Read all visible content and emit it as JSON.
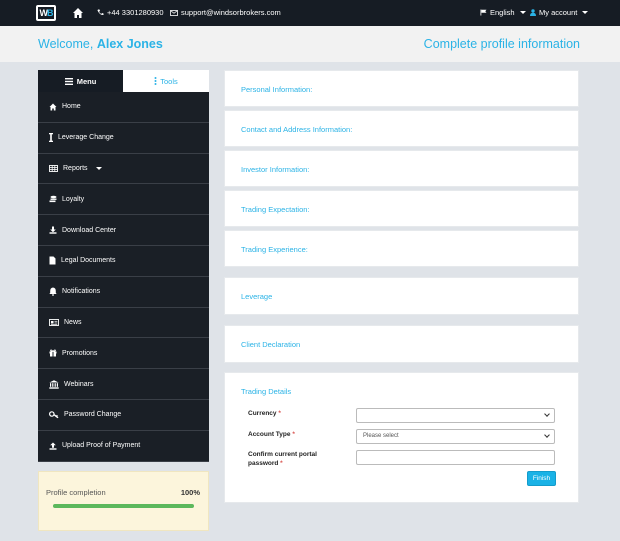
{
  "topbar": {
    "logo_w": "W",
    "logo_b": "B",
    "phone": "+44 3301280930",
    "email": "support@windsorbrokers.com",
    "language": "English",
    "account": "My account"
  },
  "welcome": {
    "greeting": "Welcome,",
    "user_name": "Alex Jones",
    "complete_profile": "Complete profile information"
  },
  "sidebar": {
    "tabs": {
      "menu": "Menu",
      "tools": "Tools"
    },
    "items": [
      {
        "label": "Home",
        "icon": "home-icon"
      },
      {
        "label": "Leverage Change",
        "icon": "leverage-icon"
      },
      {
        "label": "Reports",
        "icon": "table-icon"
      },
      {
        "label": "Loyalty",
        "icon": "coins-icon"
      },
      {
        "label": "Download Center",
        "icon": "download-icon"
      },
      {
        "label": "Legal Documents",
        "icon": "file-icon"
      },
      {
        "label": "Notifications",
        "icon": "bell-icon"
      },
      {
        "label": "News",
        "icon": "newspaper-icon"
      },
      {
        "label": "Promotions",
        "icon": "gift-icon"
      },
      {
        "label": "Webinars",
        "icon": "bank-icon"
      },
      {
        "label": "Password Change",
        "icon": "key-icon"
      },
      {
        "label": "Upload Proof of Payment",
        "icon": "upload-icon"
      }
    ],
    "profile_completion": {
      "label": "Profile completion",
      "value": "100%",
      "fraction": 1.0
    }
  },
  "sections": {
    "personal": "Personal Information:",
    "contact": "Contact and Address Information:",
    "investor": "Investor Information:",
    "trading_expectation": "Trading Expectation:",
    "trading_experience": "Trading Experience:",
    "leverage": "Leverage",
    "client_declaration": "Client Declaration",
    "trading_details": "Trading Details"
  },
  "form": {
    "currency_label": "Currency",
    "currency_value": "",
    "account_type_label": "Account Type",
    "account_type_value": "Please select",
    "password_label_1": "Confirm current portal",
    "password_label_2": "password",
    "password_value": "",
    "required_mark": "*",
    "finish_label": "Finish"
  },
  "colors": {
    "accent": "#2bb3e6",
    "dark": "#161c24",
    "progress": "#5cb85c",
    "required": "#d9534f"
  }
}
